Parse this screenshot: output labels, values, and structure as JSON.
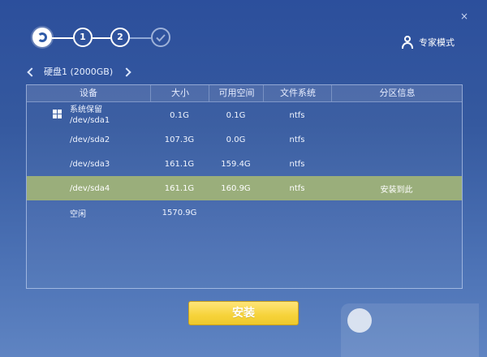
{
  "window": {
    "close_glyph": "×"
  },
  "wizard": {
    "step1": "1",
    "step2": "2",
    "step3_icon": "check-circle-icon",
    "logo_icon": "app-logo-icon",
    "active_step": 2
  },
  "expert_mode": {
    "label": "专家模式",
    "icon": "user-icon"
  },
  "disk_selector": {
    "label": "硬盘1 (2000GB)",
    "prev_icon": "chevron-left-icon",
    "next_icon": "chevron-right-icon"
  },
  "table": {
    "headers": [
      "设备",
      "大小",
      "可用空间",
      "文件系统",
      "分区信息"
    ],
    "rows": [
      {
        "device_line1": "系统保留",
        "device_line2": "/dev/sda1",
        "size": "0.1G",
        "free": "0.1G",
        "fs": "ntfs",
        "info": "",
        "os_icon": "windows-logo-icon"
      },
      {
        "device_line1": "/dev/sda2",
        "device_line2": "",
        "size": "107.3G",
        "free": "0.0G",
        "fs": "ntfs",
        "info": ""
      },
      {
        "device_line1": "/dev/sda3",
        "device_line2": "",
        "size": "161.1G",
        "free": "159.4G",
        "fs": "ntfs",
        "info": ""
      },
      {
        "device_line1": "/dev/sda4",
        "device_line2": "",
        "size": "161.1G",
        "free": "160.9G",
        "fs": "ntfs",
        "info": "安装到此"
      },
      {
        "device_line1": "空闲",
        "device_line2": "",
        "size": "1570.9G",
        "free": "",
        "fs": "",
        "info": ""
      }
    ],
    "selected_row_index": 3
  },
  "actions": {
    "install_label": "安装"
  },
  "colors": {
    "background_blue": "#2c4f9c",
    "selected_row": "#9aae7b",
    "install_yellow": "#f6d33a",
    "border": "#dce8ff"
  }
}
